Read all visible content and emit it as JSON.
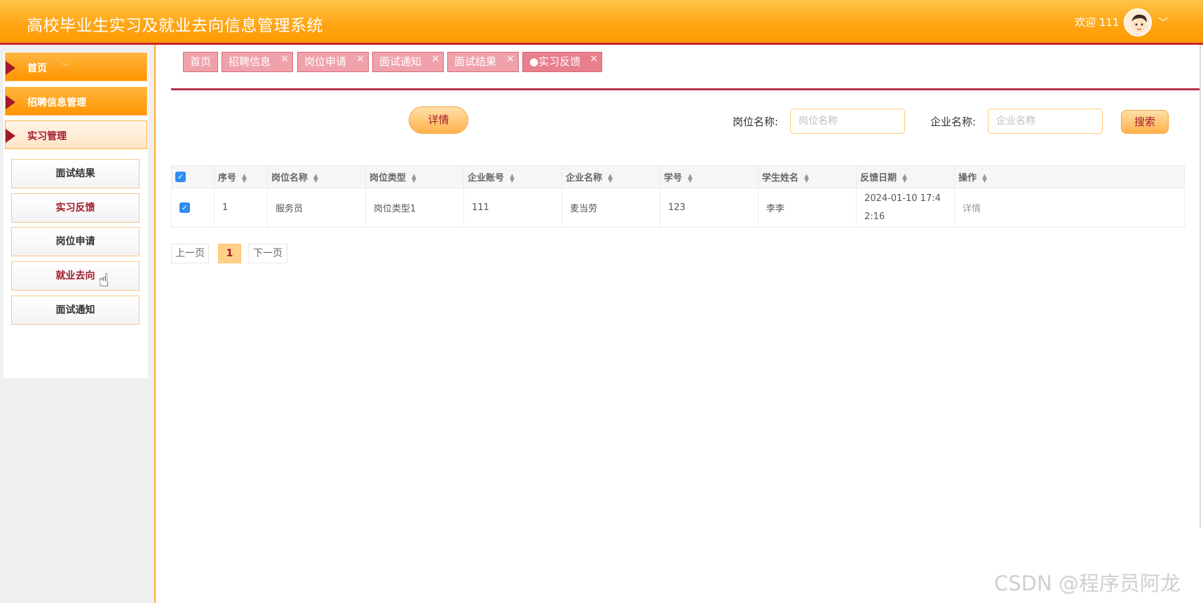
{
  "header": {
    "title": "高校毕业生实习及就业去向信息管理系统",
    "welcome": "欢迎 111"
  },
  "sidebar": {
    "menus": [
      {
        "label": "首页",
        "chevron": "﹀"
      },
      {
        "label": "招聘信息管理"
      },
      {
        "label": "实习管理"
      }
    ],
    "sub_items": [
      "面试结果",
      "实习反馈",
      "岗位申请",
      "就业去向",
      "面试通知"
    ]
  },
  "tabs": [
    {
      "label": "首页",
      "closable": false
    },
    {
      "label": "招聘信息",
      "closable": true
    },
    {
      "label": "岗位申请",
      "closable": true
    },
    {
      "label": "面试通知",
      "closable": true
    },
    {
      "label": "面试结果",
      "closable": true
    },
    {
      "label": "●实习反馈",
      "closable": true
    }
  ],
  "toolbar": {
    "detail_button": "详情",
    "job_name_label": "岗位名称:",
    "job_name_placeholder": "岗位名称",
    "company_name_label": "企业名称:",
    "company_name_placeholder": "企业名称",
    "search_button": "搜索"
  },
  "table": {
    "columns": [
      "序号",
      "岗位名称",
      "岗位类型",
      "企业账号",
      "企业名称",
      "学号",
      "学生姓名",
      "反馈日期",
      "操作"
    ],
    "rows": [
      {
        "index": "1",
        "job_name": "服务员",
        "job_type": "岗位类型1",
        "company_account": "111",
        "company_name": "麦当劳",
        "student_id": "123",
        "student_name": "李李",
        "feedback_date": "2024-01-10 17:42:16",
        "action": "详情"
      }
    ]
  },
  "pager": {
    "prev": "上一页",
    "page": "1",
    "next": "下一页"
  },
  "watermark": "CSDN @程序员阿龙",
  "colors": {
    "accent": "#ffa616",
    "brand_red": "#a3192c",
    "tab_pink": "#e87f8c",
    "checkbox_blue": "#2f8cf0"
  }
}
